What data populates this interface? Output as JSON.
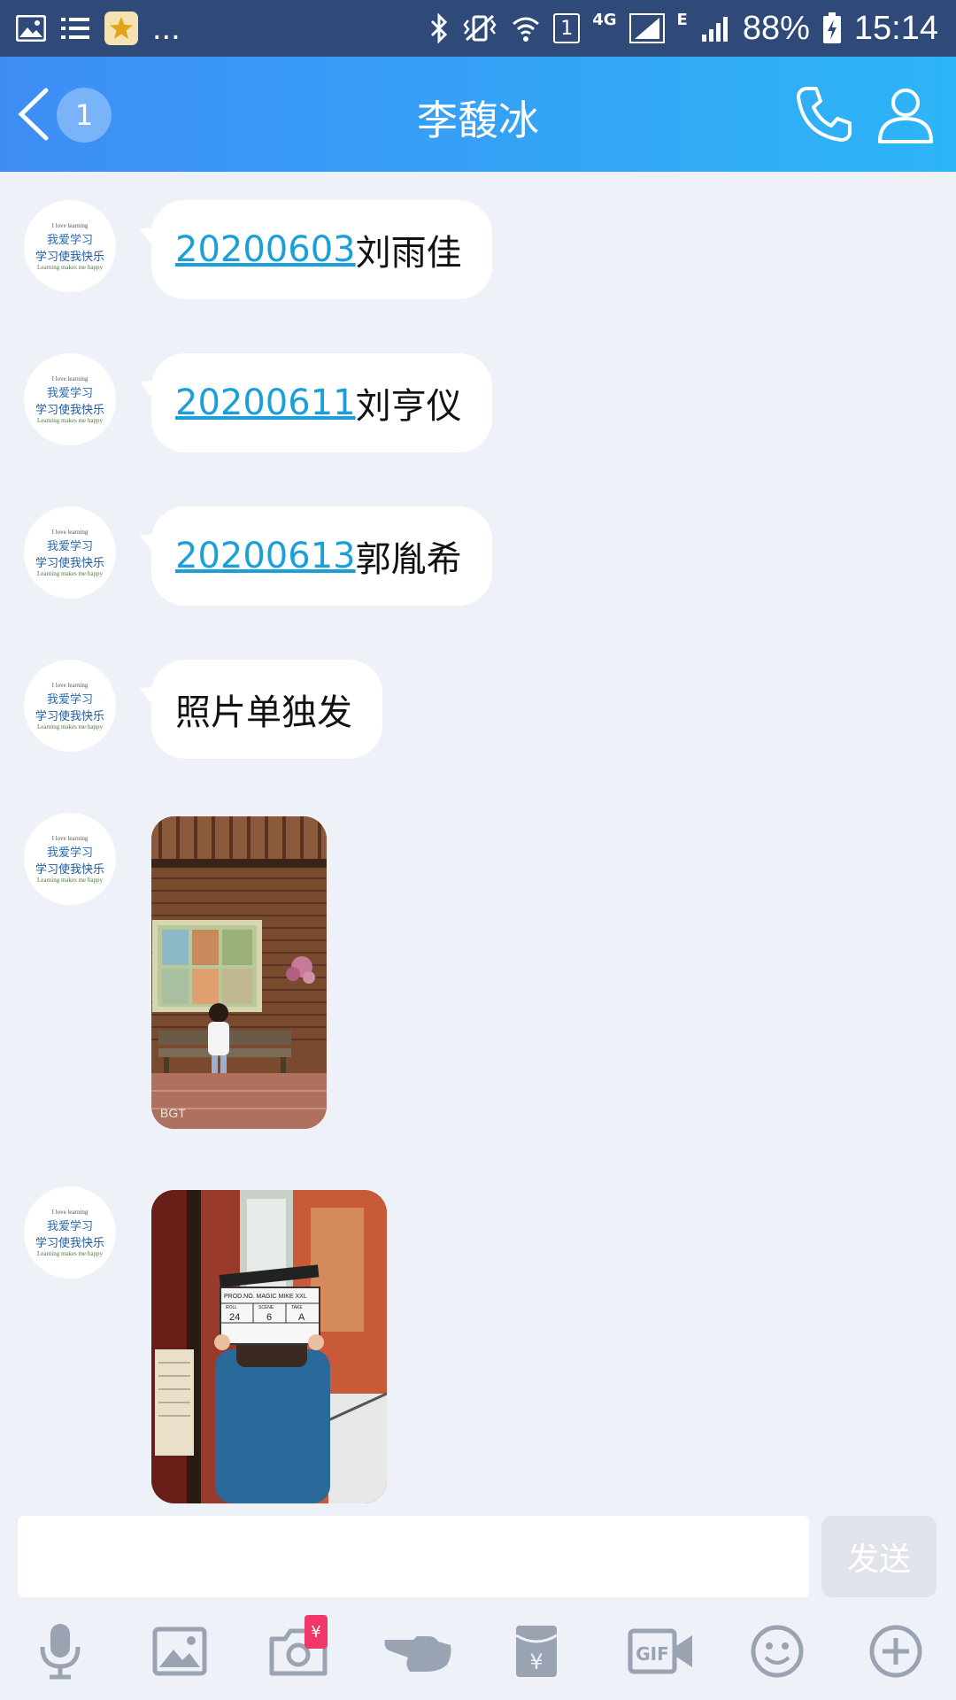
{
  "status_bar": {
    "left_extra": "...",
    "network": "4G",
    "sim_box": "1",
    "edge": "E",
    "battery": "88%",
    "time": "15:14"
  },
  "header": {
    "title": "李馥冰",
    "unread_count": "1"
  },
  "messages": [
    {
      "link": "20200603",
      "text": "刘雨佳"
    },
    {
      "link": "20200611",
      "text": "刘亨仪"
    },
    {
      "link": "20200613",
      "text": "郭胤希"
    },
    {
      "link": "",
      "text": "照片单独发"
    }
  ],
  "avatar": {
    "line1": "I love learning",
    "line2": "我爱学习",
    "line3": "学习使我快乐",
    "line4": "Learning makes me happy"
  },
  "photos": {
    "photo1_watermark": "BGT",
    "photo2_board_top": "PROD.NO. MAGIC MIKE XXL",
    "photo2_roll": "ROLL",
    "photo2_scene": "SCENE",
    "photo2_take": "TAKE",
    "photo2_v1": "24",
    "photo2_v2": "6",
    "photo2_v3": "A"
  },
  "input": {
    "placeholder": "",
    "send_label": "发送"
  },
  "toolbar": {
    "redpacket_symbol": "¥",
    "gif_label": "GIF"
  },
  "colors": {
    "header_start": "#3e8df5",
    "header_end": "#2db5f7",
    "link": "#1a9fd9",
    "background": "#eef1f7"
  },
  "icons": [
    "image-icon",
    "list-icon",
    "star-icon",
    "bluetooth-icon",
    "vibrate-icon",
    "wifi-icon",
    "signal-icon",
    "battery-icon",
    "back-icon",
    "phone-icon",
    "profile-icon",
    "microphone-icon",
    "image-picker-icon",
    "camera-icon",
    "hand-icon",
    "red-packet-icon",
    "gif-icon",
    "emoji-icon",
    "plus-icon"
  ]
}
